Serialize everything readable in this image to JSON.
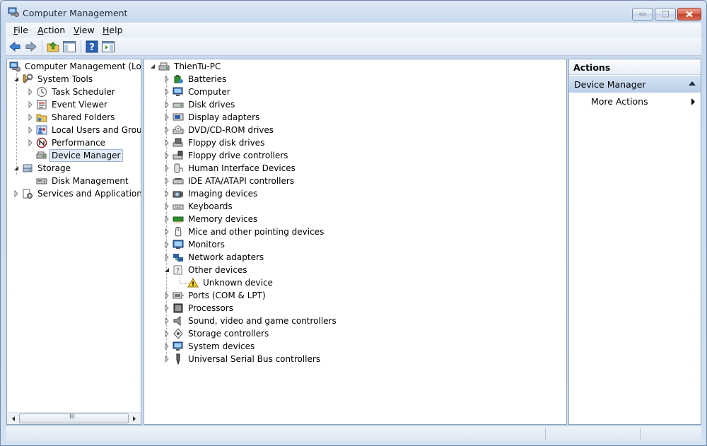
{
  "window": {
    "title": "Computer Management",
    "controls": {
      "minimize": "minimize",
      "maximize": "maximize",
      "close": "close"
    }
  },
  "menu": [
    {
      "label": "File",
      "accel": "F",
      "rest": "ile"
    },
    {
      "label": "Action",
      "accel": "A",
      "rest": "ction"
    },
    {
      "label": "View",
      "accel": "V",
      "rest": "iew"
    },
    {
      "label": "Help",
      "accel": "H",
      "rest": "elp"
    }
  ],
  "toolbar": {
    "buttons": [
      "back-arrow-icon",
      "forward-arrow-icon",
      "up-folder-icon",
      "show-hide-console-tree-icon",
      "help-icon",
      "show-hide-action-pane-icon"
    ]
  },
  "left_tree": {
    "root": "Computer Management (Local",
    "system_tools": "System Tools",
    "task_scheduler": "Task Scheduler",
    "event_viewer": "Event Viewer",
    "shared_folders": "Shared Folders",
    "local_users": "Local Users and Groups",
    "performance": "Performance",
    "device_manager": "Device Manager",
    "storage": "Storage",
    "disk_management": "Disk Management",
    "services": "Services and Applications",
    "scroll_grip": "III"
  },
  "device_tree": {
    "computer_name": "ThienTu-PC",
    "categories": [
      "Batteries",
      "Computer",
      "Disk drives",
      "Display adapters",
      "DVD/CD-ROM drives",
      "Floppy disk drives",
      "Floppy drive controllers",
      "Human Interface Devices",
      "IDE ATA/ATAPI controllers",
      "Imaging devices",
      "Keyboards",
      "Memory devices",
      "Mice and other pointing devices",
      "Monitors",
      "Network adapters",
      "Other devices",
      "Unknown device",
      "Ports (COM & LPT)",
      "Processors",
      "Sound, video and game controllers",
      "Storage controllers",
      "System devices",
      "Universal Serial Bus controllers"
    ]
  },
  "actions": {
    "header": "Actions",
    "section": "Device Manager",
    "more_actions": "More Actions"
  }
}
